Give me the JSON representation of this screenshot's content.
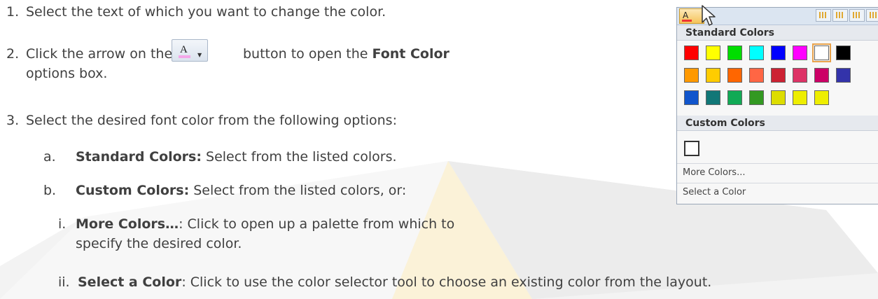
{
  "steps": {
    "s1": {
      "num": "1.",
      "text": "Select the text of which you want to change the color."
    },
    "s2": {
      "num": "2.",
      "before": "Click the arrow on the",
      "after_plain": "button to open the ",
      "after_bold": "Font Color",
      "cont": "options box."
    },
    "s3": {
      "num": "3.",
      "text": "Select the desired font color from the following options:"
    },
    "a": {
      "num": "a.",
      "bold": "Standard Colors:",
      "text": " Select from the listed colors."
    },
    "b": {
      "num": "b.",
      "bold": "Custom Colors:",
      "text": " Select from the listed colors, or:"
    },
    "i": {
      "num": "i.",
      "bold": "More Colors…",
      "text": ": Click to open up a palette from which to",
      "cont": "specify the desired color."
    },
    "ii": {
      "num": "ii.",
      "bold": "Select a Color",
      "text": ": Click to use the color selector tool to choose an existing color from the layout."
    }
  },
  "font_color_button": {
    "glyph": "A",
    "arrow": "▼"
  },
  "popup": {
    "tiny_glyph": "A",
    "standard_header": "Standard Colors",
    "custom_header": "Custom Colors",
    "more_colors": "More Colors...",
    "select_color": "Select a Color",
    "standard_colors": [
      [
        "#ff0000",
        "#ffff00",
        "#00dd00",
        "#00ffff",
        "#0000ff",
        "#ff00ff",
        "#ffffff",
        "#000000"
      ],
      [
        "#ff9900",
        "#ffcc00",
        "#ff6600",
        "#ff6644",
        "#cc2233",
        "#dd3366",
        "#cc0066",
        "#3333aa"
      ],
      [
        "#1155cc",
        "#117777",
        "#11aa55",
        "#339922",
        "#dddd00",
        "#eeee00",
        "#eeee00"
      ]
    ],
    "selected_index": 6
  }
}
